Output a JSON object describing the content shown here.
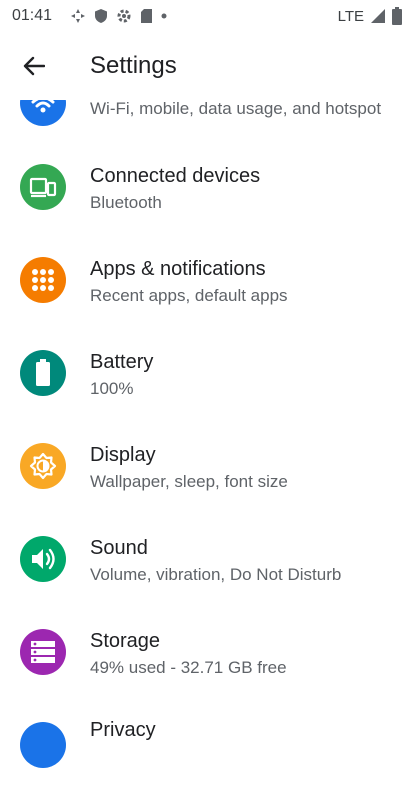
{
  "status_bar": {
    "time": "01:41",
    "network": "LTE"
  },
  "app_bar": {
    "title": "Settings"
  },
  "settings": [
    {
      "id": "network",
      "title": "",
      "subtitle": "Wi-Fi, mobile, data usage, and hotspot",
      "icon": "wifi-icon",
      "color": "#1a73e8"
    },
    {
      "id": "connected",
      "title": "Connected devices",
      "subtitle": "Bluetooth",
      "icon": "devices-icon",
      "color": "#34a853"
    },
    {
      "id": "apps",
      "title": "Apps & notifications",
      "subtitle": "Recent apps, default apps",
      "icon": "apps-icon",
      "color": "#f57c00"
    },
    {
      "id": "battery",
      "title": "Battery",
      "subtitle": "100%",
      "icon": "battery-icon",
      "color": "#00897b"
    },
    {
      "id": "display",
      "title": "Display",
      "subtitle": "Wallpaper, sleep, font size",
      "icon": "display-icon",
      "color": "#f9a825"
    },
    {
      "id": "sound",
      "title": "Sound",
      "subtitle": "Volume, vibration, Do Not Disturb",
      "icon": "sound-icon",
      "color": "#00a86b"
    },
    {
      "id": "storage",
      "title": "Storage",
      "subtitle": "49% used - 32.71 GB free",
      "icon": "storage-icon",
      "color": "#9c27b0"
    },
    {
      "id": "privacy",
      "title": "Privacy",
      "subtitle": "",
      "icon": "privacy-icon",
      "color": "#1a73e8"
    }
  ]
}
